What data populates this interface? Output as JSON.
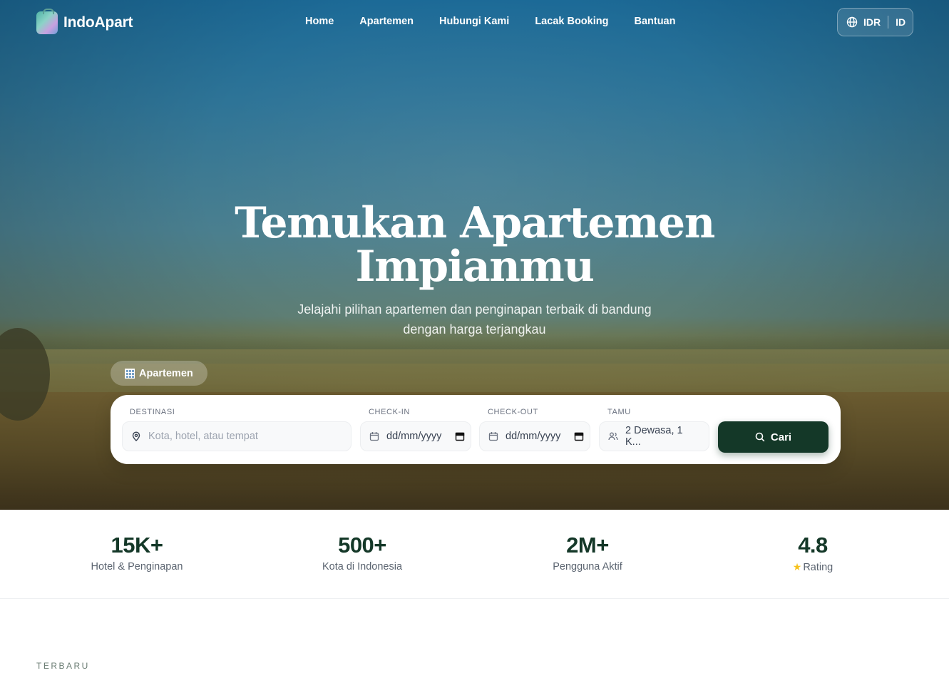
{
  "brand": {
    "name": "IndoApart"
  },
  "nav": {
    "items": [
      "Home",
      "Apartemen",
      "Hubungi Kami",
      "Lacak Booking",
      "Bantuan"
    ],
    "currency": "IDR",
    "language": "ID"
  },
  "hero": {
    "title_line1": "Temukan Apartemen",
    "title_line2": "Impianmu",
    "subtitle_line1": "Jelajahi pilihan apartemen dan penginapan terbaik di bandung",
    "subtitle_line2": "dengan harga terjangkau",
    "category_chip": "Apartemen"
  },
  "search": {
    "destination_label": "DESTINASI",
    "destination_placeholder": "Kota, hotel, atau tempat",
    "checkin_label": "CHECK-IN",
    "checkin_value": "dd/mm/yyyy",
    "checkout_label": "CHECK-OUT",
    "checkout_value": "dd/mm/yyyy",
    "guests_label": "TAMU",
    "guests_value": "2 Dewasa, 1 K...",
    "submit_label": "Cari"
  },
  "stats": [
    {
      "value": "15K+",
      "label": "Hotel & Penginapan"
    },
    {
      "value": "500+",
      "label": "Kota di Indonesia"
    },
    {
      "value": "2M+",
      "label": "Pengguna Aktif"
    },
    {
      "value": "4.8",
      "label": "Rating"
    }
  ],
  "section": {
    "eyebrow": "TERBARU"
  },
  "colors": {
    "primary": "#143828",
    "star": "#f6c21c"
  }
}
